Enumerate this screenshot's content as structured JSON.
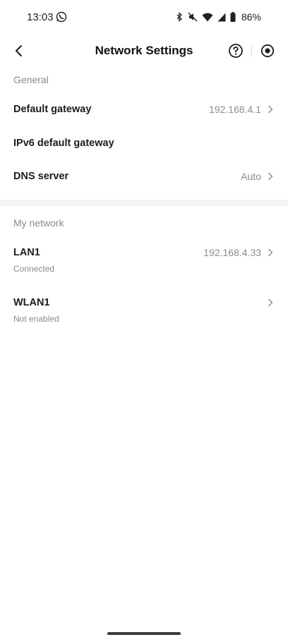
{
  "status_bar": {
    "time": "13:03",
    "battery": "86%",
    "icons": [
      "whatsapp-icon",
      "bluetooth-icon",
      "mute-icon",
      "wifi-icon",
      "signal-icon",
      "battery-icon"
    ]
  },
  "header": {
    "title": "Network Settings",
    "back_icon": "chevron-left-icon",
    "help_icon": "question-circle-icon",
    "record_icon": "record-circle-icon"
  },
  "general": {
    "label": "General",
    "items": [
      {
        "title": "Default gateway",
        "value": "192.168.4.1",
        "has_chevron": true
      },
      {
        "title": "IPv6 default gateway",
        "value": "",
        "has_chevron": false
      },
      {
        "title": "DNS server",
        "value": "Auto",
        "has_chevron": true
      }
    ]
  },
  "my_network": {
    "label": "My network",
    "items": [
      {
        "title": "LAN1",
        "subtitle": "Connected",
        "value": "192.168.4.33",
        "has_chevron": true
      },
      {
        "title": "WLAN1",
        "subtitle": "Not enabled",
        "value": "",
        "has_chevron": true
      }
    ]
  },
  "colors": {
    "title_text": "#1c1c1c",
    "secondary_text": "#8a8a8a",
    "divider_band": "#f4f4f4"
  }
}
